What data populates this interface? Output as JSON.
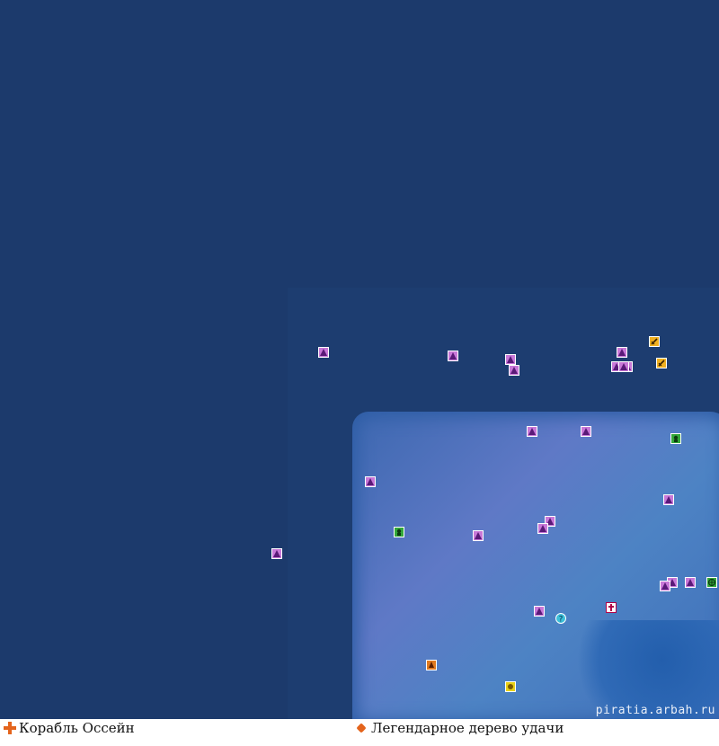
{
  "map": {
    "watermark": "piratia.arbah.ru",
    "colors": {
      "deep_sea": "#1c3a6c",
      "shallow_zone": "#1d3d70",
      "marker_pink": "#c978d8"
    }
  },
  "legend": [
    {
      "icon": "orange-cross-icon",
      "label": "Корабль Оссейн"
    },
    {
      "icon": "orange-diamond-icon",
      "label": "Легендарное дерево удачи"
    }
  ],
  "markers": [
    {
      "type": "purple-triangle",
      "name": "monster-marker"
    },
    {
      "type": "purple-triangle",
      "name": "monster-marker"
    },
    {
      "type": "purple-triangle",
      "name": "monster-marker"
    },
    {
      "type": "purple-triangle",
      "name": "monster-marker"
    },
    {
      "type": "purple-triangle",
      "name": "monster-marker"
    },
    {
      "type": "purple-triangle",
      "name": "monster-marker"
    },
    {
      "type": "purple-triangle",
      "name": "monster-marker"
    },
    {
      "type": "purple-triangle",
      "name": "monster-marker"
    },
    {
      "type": "purple-triangle",
      "name": "monster-marker"
    },
    {
      "type": "purple-triangle",
      "name": "monster-marker"
    },
    {
      "type": "purple-triangle",
      "name": "monster-marker"
    },
    {
      "type": "purple-triangle",
      "name": "monster-marker"
    },
    {
      "type": "purple-triangle",
      "name": "monster-marker"
    },
    {
      "type": "purple-triangle",
      "name": "monster-marker"
    },
    {
      "type": "purple-triangle",
      "name": "monster-marker"
    },
    {
      "type": "purple-triangle",
      "name": "monster-marker"
    },
    {
      "type": "purple-triangle",
      "name": "monster-marker"
    },
    {
      "type": "purple-triangle",
      "name": "monster-marker"
    },
    {
      "type": "purple-triangle",
      "name": "monster-marker"
    },
    {
      "type": "purple-triangle",
      "name": "monster-marker"
    },
    {
      "type": "orange-sword",
      "name": "boss-marker"
    },
    {
      "type": "orange-sword",
      "name": "boss-marker"
    },
    {
      "type": "green-npc",
      "name": "npc-marker"
    },
    {
      "type": "green-npc",
      "name": "npc-marker"
    },
    {
      "type": "green-portal",
      "name": "portal-marker"
    },
    {
      "type": "cyan-quest",
      "name": "quest-marker"
    },
    {
      "type": "white-cross",
      "name": "healer-marker"
    },
    {
      "type": "yellow-item",
      "name": "item-marker"
    },
    {
      "type": "orange-ship",
      "name": "ship-marker"
    }
  ]
}
